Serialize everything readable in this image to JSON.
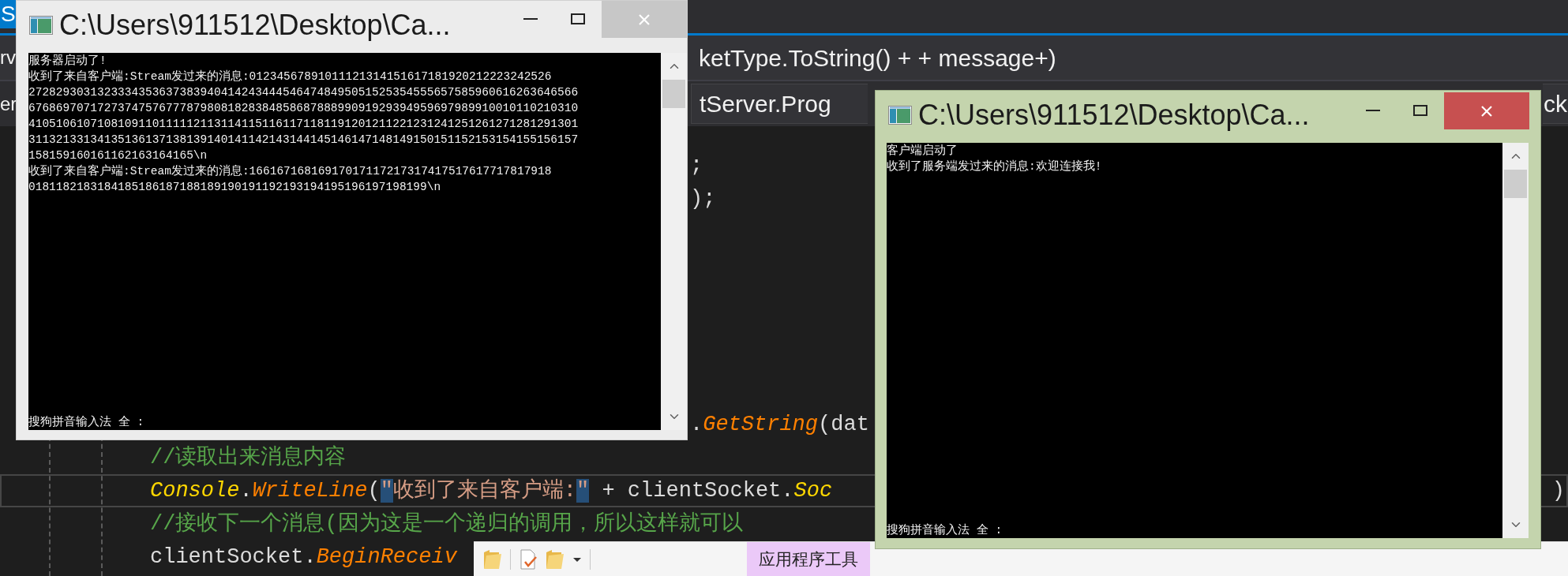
{
  "ide": {
    "app_tile": "S",
    "toolbar_row": {
      "left_fragment": "rv",
      "text": "ketType.ToString() + + message+)"
    },
    "navigation_bar": {
      "left_fragment": "er",
      "dropdowns": [
        {
          "text": "tServer.Prog"
        },
        {
          "text": "ck"
        }
      ]
    },
    "upper_code_lines": [
      {
        "kind": "partial",
        "current": false,
        "tokens": [
          {
            "text": ";",
            "kind": "plain"
          }
        ]
      },
      {
        "kind": "partial",
        "current": false,
        "tokens": [
          {
            "text": ");",
            "kind": "plain"
          }
        ]
      }
    ],
    "lower_code_lines": [
      {
        "kind": "partial",
        "current": false,
        "tokens": [
          {
            "text": ".",
            "kind": "plain"
          },
          {
            "text": "GetString",
            "kind": "method"
          },
          {
            "text": "(dat",
            "kind": "plain"
          }
        ]
      },
      {
        "kind": "full",
        "current": false,
        "tokens": [
          {
            "text": "//读取出来消息内容",
            "kind": "comment"
          }
        ]
      },
      {
        "kind": "full",
        "current": true,
        "tokens": [
          {
            "text": "Console",
            "kind": "class"
          },
          {
            "text": ".",
            "kind": "plain"
          },
          {
            "text": "WriteLine",
            "kind": "method"
          },
          {
            "text": "(",
            "kind": "plain"
          },
          {
            "text": "\"",
            "kind": "highlight"
          },
          {
            "text": "收到了来自客户端:",
            "kind": "string"
          },
          {
            "text": "\"",
            "kind": "highlight"
          },
          {
            "text": " + clientSocket.",
            "kind": "plain"
          },
          {
            "text": "Soc",
            "kind": "class"
          }
        ],
        "tail": ")"
      },
      {
        "kind": "full",
        "current": false,
        "tokens": [
          {
            "text": "//接收下一个消息(因为这是一个递归的调用，所以这样就可以",
            "kind": "comment"
          }
        ]
      },
      {
        "kind": "full",
        "current": false,
        "tokens": [
          {
            "text": "clientSocket.",
            "kind": "plain"
          },
          {
            "text": "BeginReceiv",
            "kind": "method"
          }
        ]
      }
    ]
  },
  "explorer_ribbon": {
    "context_tab": "应用程序工具"
  },
  "windows": [
    {
      "title": "C:\\Users\\911512\\Desktop\\Ca...",
      "active": false,
      "lines": [
        "服务器启动了!",
        "收到了来自客户端:Stream发过来的消息:01234567891011121314151617181920212223242526",
        "27282930313233343536373839404142434445464748495051525354555657585960616263646566",
        "67686970717273747576777879808182838485868788899091929394959697989910010110210310",
        "41051061071081091101111121131141151161171181191201211221231241251261271281291301",
        "31132133134135136137138139140141142143144145146147148149150151152153154155156157",
        "158159160161162163164165\\n",
        "收到了来自客户端:Stream发过来的消息:16616716816917017117217317417517617717817918",
        "0181182183184185186187188189190191192193194195196197198199\\n"
      ],
      "ime_status": "搜狗拼音输入法 全 :"
    },
    {
      "title": "C:\\Users\\911512\\Desktop\\Ca...",
      "active": true,
      "lines": [
        "客户端启动了",
        "收到了服务端发过来的消息:欢迎连接我!"
      ],
      "ime_status": "搜狗拼音输入法 全 :"
    }
  ]
}
